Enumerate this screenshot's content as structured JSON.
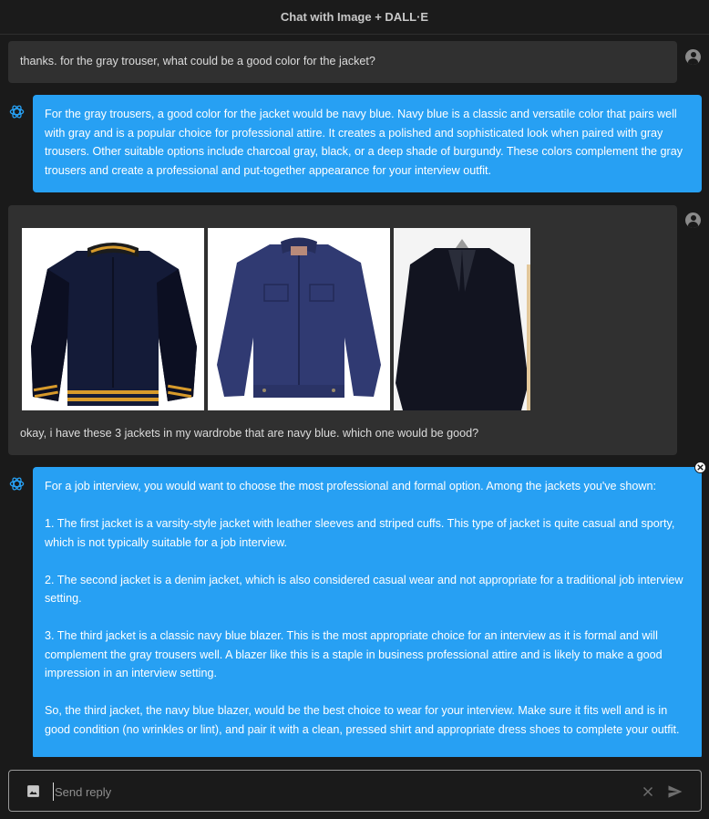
{
  "window": {
    "title": "Chat with Image + DALL·E"
  },
  "messages": {
    "user_1": "thanks. for the gray trouser, what could be a good color for the jacket?",
    "bot_1": "For the gray trousers, a good color for the jacket would be navy blue. Navy blue is a classic and versatile color that pairs well with gray and is a popular choice for professional attire. It creates a polished and sophisticated look when paired with gray trousers. Other suitable options include charcoal gray, black, or a deep shade of burgundy. These colors complement the gray trousers and create a professional and put-together appearance for your interview outfit.",
    "user_2": {
      "images": [
        "navy varsity jacket",
        "navy denim jacket",
        "navy blazer"
      ],
      "text": "okay, i have these 3 jackets in my wardrobe that are navy blue. which one would be good?"
    },
    "bot_2": {
      "paragraphs": [
        "For a job interview, you would want to choose the most professional and formal option. Among the jackets you've shown:",
        "1. The first jacket is a varsity-style jacket with leather sleeves and striped cuffs. This type of jacket is quite casual and sporty, which is not typically suitable for a job interview.",
        "2. The second jacket is a denim jacket, which is also considered casual wear and not appropriate for a traditional job interview setting.",
        "3. The third jacket is a classic navy blue blazer. This is the most appropriate choice for an interview as it is formal and will complement the gray trousers well. A blazer like this is a staple in business professional attire and is likely to make a good impression in an interview setting.",
        "So, the third jacket, the navy blue blazer, would be the best choice to wear for your interview. Make sure it fits well and is in good condition (no wrinkles or lint), and pair it with a clean, pressed shirt and appropriate dress shoes to complete your outfit."
      ]
    }
  },
  "composer": {
    "placeholder": "Send reply",
    "value": ""
  },
  "icons": {
    "bot": "openai-logo-icon",
    "user": "user-avatar-icon",
    "attach": "image-icon",
    "clear": "close-icon",
    "send": "send-icon",
    "dismiss": "close-circle-icon"
  },
  "colors": {
    "background": "#1a1a1a",
    "user_bubble": "#303030",
    "bot_bubble": "#27a0f3"
  }
}
